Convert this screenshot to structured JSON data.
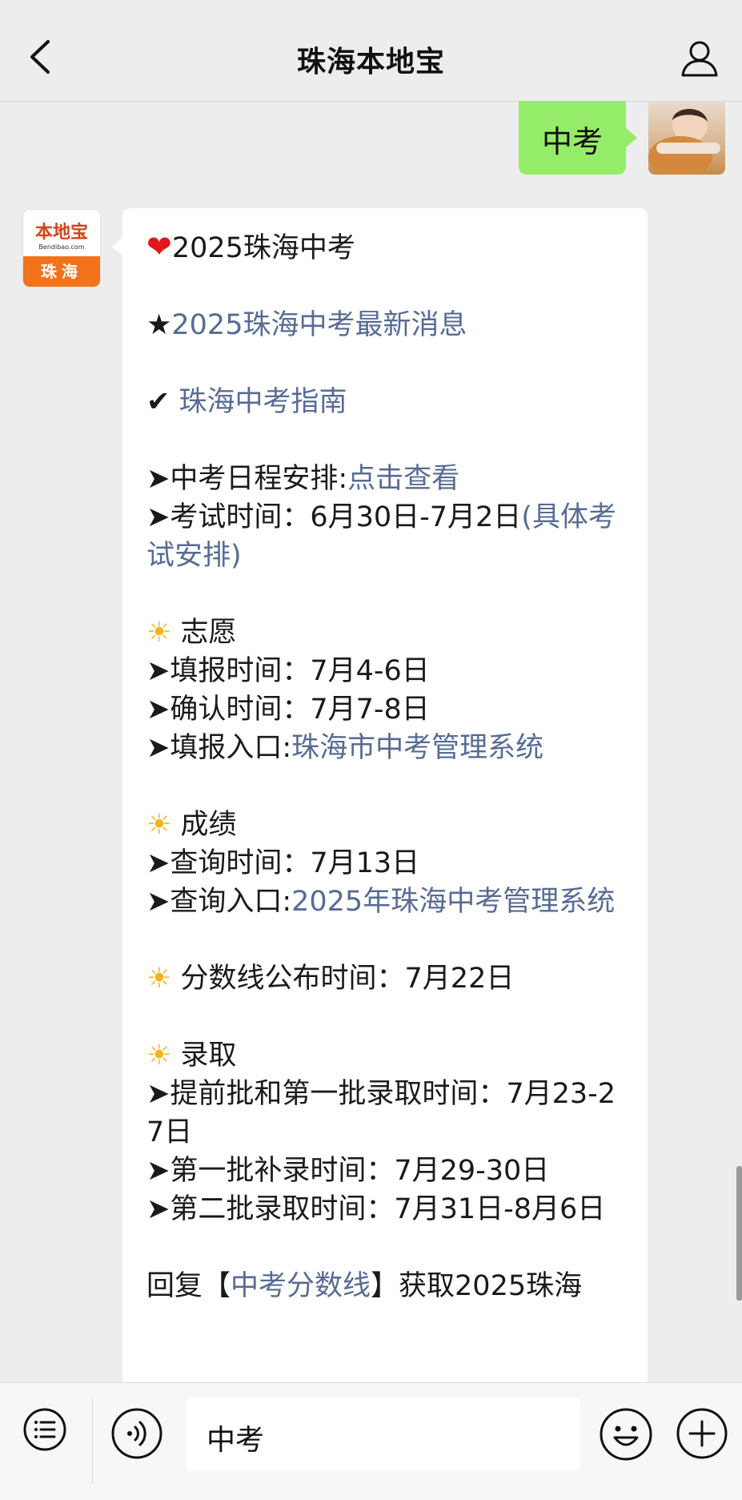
{
  "header": {
    "title": "珠海本地宝"
  },
  "chat": {
    "user_message": "中考",
    "bot_avatar": {
      "logo_text": "本地宝",
      "logo_sub": "Bendibao.com",
      "city": "珠海"
    },
    "reply": {
      "title": "2025珠海中考",
      "news_link": "2025珠海中考最新消息",
      "guide_link": "珠海中考指南",
      "schedule_label": "➤中考日程安排:",
      "schedule_link": "点击查看",
      "exam_time_text": "➤考试时间：6月30日-7月2日",
      "exam_detail_link": "(具体考试安排)",
      "zhiyuan_heading": "志愿",
      "fill_time": "➤填报时间：7月4-6日",
      "confirm_time": "➤确认时间：7月7-8日",
      "fill_entry_label": "➤填报入口:",
      "fill_entry_link": "珠海市中考管理系统",
      "score_heading": "成绩",
      "query_time": "➤查询时间：7月13日",
      "query_entry_label": "➤查询入口:",
      "query_entry_link": "2025年珠海中考管理系统",
      "cutoff_text": "分数线公布时间：7月22日",
      "admission_heading": "录取",
      "admission_early": "➤提前批和第一批录取时间：7月23-27日",
      "admission_supplement": "➤第一批补录时间：7月29-30日",
      "admission_second": "➤第二批录取时间：7月31日-8月6日",
      "reply_prefix": "回复【",
      "reply_link": "中考分数线",
      "reply_suffix": "】获取2025珠海"
    }
  },
  "input_bar": {
    "text": "中考"
  },
  "colors": {
    "background": "#ededed",
    "self_bubble": "#95ec69",
    "link": "#576b95",
    "brand_orange": "#f2731c"
  }
}
